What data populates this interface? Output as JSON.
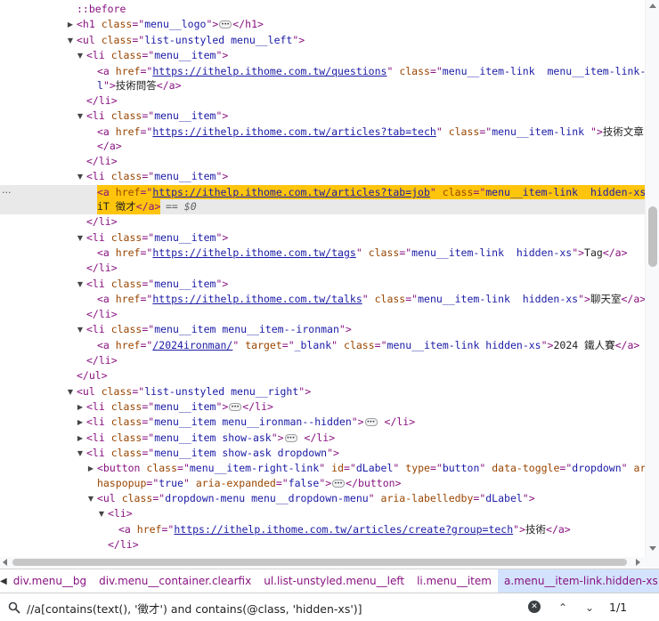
{
  "dom_tree": {
    "lines": [
      [
        {
          "c": "pseudo",
          "t": "::before"
        }
      ],
      [
        {
          "c": "tag",
          "t": "<h1 "
        },
        {
          "c": "attr",
          "t": "class"
        },
        {
          "c": "tag",
          "t": "=\""
        },
        {
          "c": "val",
          "t": "menu__logo"
        },
        {
          "c": "tag",
          "t": "\">"
        },
        {
          "c": "ell"
        },
        {
          "c": "tag",
          "t": "</h1>"
        }
      ],
      [
        {
          "c": "tag",
          "t": "<ul "
        },
        {
          "c": "attr",
          "t": "class"
        },
        {
          "c": "tag",
          "t": "=\""
        },
        {
          "c": "val",
          "t": "list-unstyled menu__left"
        },
        {
          "c": "tag",
          "t": "\">"
        }
      ],
      [
        {
          "c": "tag",
          "t": "<li "
        },
        {
          "c": "attr",
          "t": "class"
        },
        {
          "c": "tag",
          "t": "=\""
        },
        {
          "c": "val",
          "t": "menu__item"
        },
        {
          "c": "tag",
          "t": "\">"
        }
      ],
      [
        {
          "c": "tag",
          "t": "<a "
        },
        {
          "c": "attr",
          "t": "href"
        },
        {
          "c": "tag",
          "t": "=\""
        },
        {
          "c": "link",
          "t": "https://ithelp.ithome.com.tw/questions"
        },
        {
          "c": "tag",
          "t": "\" "
        },
        {
          "c": "attr",
          "t": "class"
        },
        {
          "c": "tag",
          "t": "=\""
        },
        {
          "c": "val",
          "t": "menu__item-link  menu__item-link--p"
        }
      ],
      [
        {
          "c": "val",
          "t": "l"
        },
        {
          "c": "tag",
          "t": "\">"
        },
        {
          "c": "txt",
          "t": "技術問答"
        },
        {
          "c": "tag",
          "t": "</a>"
        }
      ],
      [
        {
          "c": "tag",
          "t": "</li>"
        }
      ],
      [
        {
          "c": "tag",
          "t": "<li "
        },
        {
          "c": "attr",
          "t": "class"
        },
        {
          "c": "tag",
          "t": "=\""
        },
        {
          "c": "val",
          "t": "menu__item"
        },
        {
          "c": "tag",
          "t": "\">"
        }
      ],
      [
        {
          "c": "tag",
          "t": "<a "
        },
        {
          "c": "attr",
          "t": "href"
        },
        {
          "c": "tag",
          "t": "=\""
        },
        {
          "c": "link",
          "t": "https://ithelp.ithome.com.tw/articles?tab=tech"
        },
        {
          "c": "tag",
          "t": "\" "
        },
        {
          "c": "attr",
          "t": "class"
        },
        {
          "c": "tag",
          "t": "=\""
        },
        {
          "c": "val",
          "t": "menu__item-link "
        },
        {
          "c": "tag",
          "t": "\">"
        },
        {
          "c": "txt",
          "t": "技術文章"
        }
      ],
      [
        {
          "c": "tag",
          "t": "</a>"
        }
      ],
      [
        {
          "c": "tag",
          "t": "</li>"
        }
      ],
      [
        {
          "c": "tag",
          "t": "<li "
        },
        {
          "c": "attr",
          "t": "class"
        },
        {
          "c": "tag",
          "t": "=\""
        },
        {
          "c": "val",
          "t": "menu__item"
        },
        {
          "c": "tag",
          "t": "\">"
        }
      ],
      [
        {
          "c": "tag",
          "t": "<a "
        },
        {
          "c": "attr",
          "t": "href"
        },
        {
          "c": "tag",
          "t": "=\""
        },
        {
          "c": "link",
          "t": "https://ithelp.ithome.com.tw/articles?tab=job"
        },
        {
          "c": "tag",
          "t": "\" "
        },
        {
          "c": "attr",
          "t": "class"
        },
        {
          "c": "tag",
          "t": "=\""
        },
        {
          "c": "val",
          "t": "menu__item-link  hidden-xs"
        },
        {
          "c": "tag",
          "t": "\">"
        }
      ],
      [
        {
          "c": "txt",
          "t": "iT 徵才"
        },
        {
          "c": "tag",
          "t": "</a>"
        }
      ],
      [
        {
          "c": "tag",
          "t": "</li>"
        }
      ],
      [
        {
          "c": "tag",
          "t": "<li "
        },
        {
          "c": "attr",
          "t": "class"
        },
        {
          "c": "tag",
          "t": "=\""
        },
        {
          "c": "val",
          "t": "menu__item"
        },
        {
          "c": "tag",
          "t": "\">"
        }
      ],
      [
        {
          "c": "tag",
          "t": "<a "
        },
        {
          "c": "attr",
          "t": "href"
        },
        {
          "c": "tag",
          "t": "=\""
        },
        {
          "c": "link",
          "t": "https://ithelp.ithome.com.tw/tags"
        },
        {
          "c": "tag",
          "t": "\" "
        },
        {
          "c": "attr",
          "t": "class"
        },
        {
          "c": "tag",
          "t": "=\""
        },
        {
          "c": "val",
          "t": "menu__item-link  hidden-xs"
        },
        {
          "c": "tag",
          "t": "\">"
        },
        {
          "c": "txt",
          "t": "Tag"
        },
        {
          "c": "tag",
          "t": "</a>"
        }
      ],
      [
        {
          "c": "tag",
          "t": "</li>"
        }
      ],
      [
        {
          "c": "tag",
          "t": "<li "
        },
        {
          "c": "attr",
          "t": "class"
        },
        {
          "c": "tag",
          "t": "=\""
        },
        {
          "c": "val",
          "t": "menu__item"
        },
        {
          "c": "tag",
          "t": "\">"
        }
      ],
      [
        {
          "c": "tag",
          "t": "<a "
        },
        {
          "c": "attr",
          "t": "href"
        },
        {
          "c": "tag",
          "t": "=\""
        },
        {
          "c": "link",
          "t": "https://ithelp.ithome.com.tw/talks"
        },
        {
          "c": "tag",
          "t": "\" "
        },
        {
          "c": "attr",
          "t": "class"
        },
        {
          "c": "tag",
          "t": "=\""
        },
        {
          "c": "val",
          "t": "menu__item-link  hidden-xs"
        },
        {
          "c": "tag",
          "t": "\">"
        },
        {
          "c": "txt",
          "t": "聊天室"
        },
        {
          "c": "tag",
          "t": "</a>"
        }
      ],
      [
        {
          "c": "tag",
          "t": "</li>"
        }
      ],
      [
        {
          "c": "tag",
          "t": "<li "
        },
        {
          "c": "attr",
          "t": "class"
        },
        {
          "c": "tag",
          "t": "=\""
        },
        {
          "c": "val",
          "t": "menu__item menu__item--ironman"
        },
        {
          "c": "tag",
          "t": "\">"
        }
      ],
      [
        {
          "c": "tag",
          "t": "<a "
        },
        {
          "c": "attr",
          "t": "href"
        },
        {
          "c": "tag",
          "t": "=\""
        },
        {
          "c": "link",
          "t": "/2024ironman/"
        },
        {
          "c": "tag",
          "t": "\" "
        },
        {
          "c": "attr",
          "t": "target"
        },
        {
          "c": "tag",
          "t": "=\""
        },
        {
          "c": "val",
          "t": "_blank"
        },
        {
          "c": "tag",
          "t": "\" "
        },
        {
          "c": "attr",
          "t": "class"
        },
        {
          "c": "tag",
          "t": "=\""
        },
        {
          "c": "val",
          "t": "menu__item-link hidden-xs"
        },
        {
          "c": "tag",
          "t": "\">"
        },
        {
          "c": "txt",
          "t": "2024 鐵人賽"
        },
        {
          "c": "tag",
          "t": "</a>"
        }
      ],
      [
        {
          "c": "tag",
          "t": "</li>"
        }
      ],
      [
        {
          "c": "tag",
          "t": "</ul>"
        }
      ],
      [
        {
          "c": "tag",
          "t": "<ul "
        },
        {
          "c": "attr",
          "t": "class"
        },
        {
          "c": "tag",
          "t": "=\""
        },
        {
          "c": "val",
          "t": "list-unstyled menu__right"
        },
        {
          "c": "tag",
          "t": "\">"
        }
      ],
      [
        {
          "c": "tag",
          "t": "<li "
        },
        {
          "c": "attr",
          "t": "class"
        },
        {
          "c": "tag",
          "t": "=\""
        },
        {
          "c": "val",
          "t": "menu__item"
        },
        {
          "c": "tag",
          "t": "\">"
        },
        {
          "c": "ell"
        },
        {
          "c": "tag",
          "t": "</li>"
        }
      ],
      [
        {
          "c": "tag",
          "t": "<li "
        },
        {
          "c": "attr",
          "t": "class"
        },
        {
          "c": "tag",
          "t": "=\""
        },
        {
          "c": "val",
          "t": "menu__item menu__ironman--hidden"
        },
        {
          "c": "tag",
          "t": "\">"
        },
        {
          "c": "ell"
        },
        {
          "c": "tag",
          "t": " </li>"
        }
      ],
      [
        {
          "c": "tag",
          "t": "<li "
        },
        {
          "c": "attr",
          "t": "class"
        },
        {
          "c": "tag",
          "t": "=\""
        },
        {
          "c": "val",
          "t": "menu__item show-ask"
        },
        {
          "c": "tag",
          "t": "\">"
        },
        {
          "c": "ell"
        },
        {
          "c": "tag",
          "t": " </li>"
        }
      ],
      [
        {
          "c": "tag",
          "t": "<li "
        },
        {
          "c": "attr",
          "t": "class"
        },
        {
          "c": "tag",
          "t": "=\""
        },
        {
          "c": "val",
          "t": "menu__item show-ask dropdown"
        },
        {
          "c": "tag",
          "t": "\">"
        }
      ],
      [
        {
          "c": "tag",
          "t": "<button "
        },
        {
          "c": "attr",
          "t": "class"
        },
        {
          "c": "tag",
          "t": "=\""
        },
        {
          "c": "val",
          "t": "menu__item-right-link"
        },
        {
          "c": "tag",
          "t": "\" "
        },
        {
          "c": "attr",
          "t": "id"
        },
        {
          "c": "tag",
          "t": "=\""
        },
        {
          "c": "val",
          "t": "dLabel"
        },
        {
          "c": "tag",
          "t": "\" "
        },
        {
          "c": "attr",
          "t": "type"
        },
        {
          "c": "tag",
          "t": "=\""
        },
        {
          "c": "val",
          "t": "button"
        },
        {
          "c": "tag",
          "t": "\" "
        },
        {
          "c": "attr",
          "t": "data-toggle"
        },
        {
          "c": "tag",
          "t": "=\""
        },
        {
          "c": "val",
          "t": "dropdown"
        },
        {
          "c": "tag",
          "t": "\" "
        },
        {
          "c": "attr",
          "t": "aria-"
        }
      ],
      [
        {
          "c": "attr",
          "t": "haspopup"
        },
        {
          "c": "tag",
          "t": "=\""
        },
        {
          "c": "val",
          "t": "true"
        },
        {
          "c": "tag",
          "t": "\" "
        },
        {
          "c": "attr",
          "t": "aria-expanded"
        },
        {
          "c": "tag",
          "t": "=\""
        },
        {
          "c": "val",
          "t": "false"
        },
        {
          "c": "tag",
          "t": "\">"
        },
        {
          "c": "ell"
        },
        {
          "c": "tag",
          "t": "</button>"
        }
      ],
      [
        {
          "c": "tag",
          "t": "<ul "
        },
        {
          "c": "attr",
          "t": "class"
        },
        {
          "c": "tag",
          "t": "=\""
        },
        {
          "c": "val",
          "t": "dropdown-menu menu__dropdown-menu"
        },
        {
          "c": "tag",
          "t": "\" "
        },
        {
          "c": "attr",
          "t": "aria-labelledby"
        },
        {
          "c": "tag",
          "t": "=\""
        },
        {
          "c": "val",
          "t": "dLabel"
        },
        {
          "c": "tag",
          "t": "\">"
        }
      ],
      [
        {
          "c": "tag",
          "t": "<li>"
        }
      ],
      [
        {
          "c": "tag",
          "t": "<a "
        },
        {
          "c": "attr",
          "t": "href"
        },
        {
          "c": "tag",
          "t": "=\""
        },
        {
          "c": "link",
          "t": "https://ithelp.ithome.com.tw/articles/create?group=tech"
        },
        {
          "c": "tag",
          "t": "\">"
        },
        {
          "c": "txt",
          "t": "技術"
        },
        {
          "c": "tag",
          "t": "</a>"
        }
      ],
      [
        {
          "c": "tag",
          "t": "</li>"
        }
      ]
    ],
    "selected_suffix": "== $0"
  },
  "breadcrumb": {
    "items": [
      "div.menu__bg",
      "div.menu__container.clearfix",
      "ul.list-unstyled.menu__left",
      "li.menu__item",
      "a.menu__item-link.hidden-xs"
    ]
  },
  "search": {
    "query": "//a[contains(text(), '徵才') and contains(@class, 'hidden-xs')]",
    "result_count": "1/1"
  },
  "colors": {
    "tag": "#881280",
    "attr": "#994500",
    "value": "#1a1aa6",
    "highlight": "#ffc50d",
    "breadcrumb_active": "#d3e3fd"
  }
}
